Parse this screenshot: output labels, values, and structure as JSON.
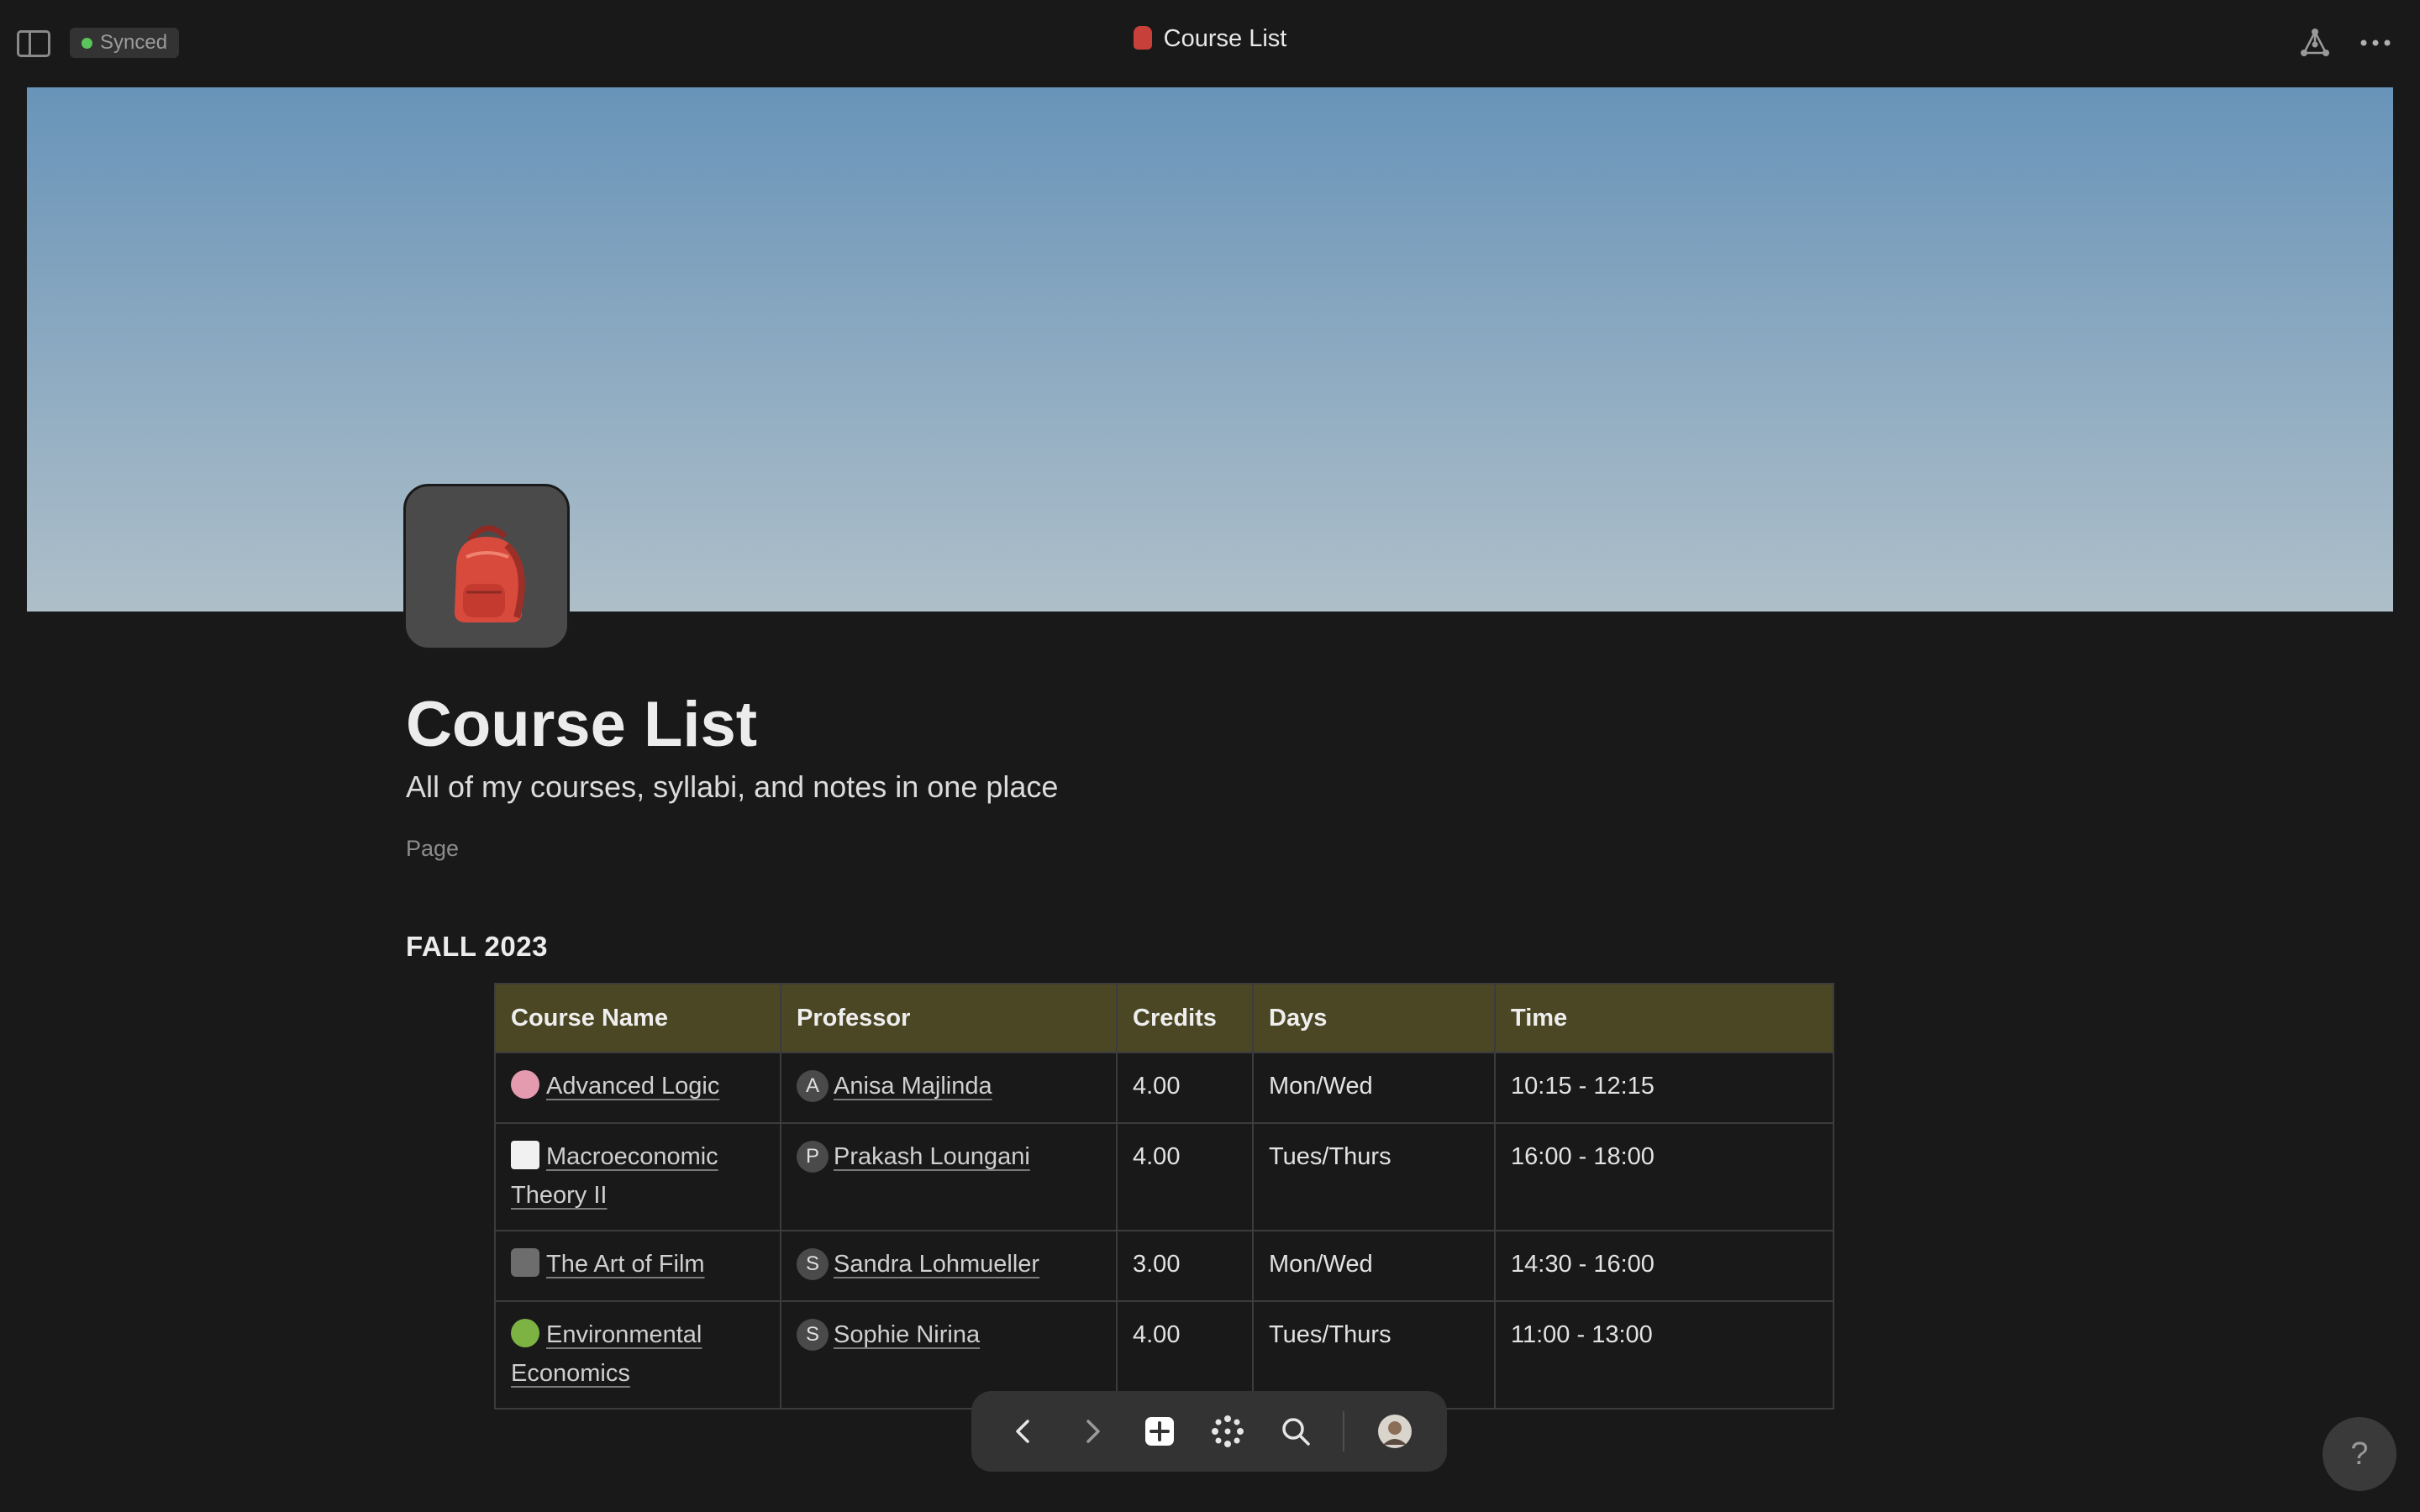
{
  "topbar": {
    "sync_status": "Synced",
    "title": "Course List"
  },
  "page": {
    "title": "Course List",
    "subtitle": "All of my courses, syllabi, and notes in one place",
    "type_label": "Page",
    "section_heading": "FALL 2023"
  },
  "table": {
    "headers": [
      "Course Name",
      "Professor",
      "Credits",
      "Days",
      "Time"
    ],
    "rows": [
      {
        "icon": "brain-emoji",
        "course": "Advanced Logic",
        "prof_initial": "A",
        "professor": "Anisa Majlinda",
        "credits": "4.00",
        "days": "Mon/Wed",
        "time": "10:15 - 12:15"
      },
      {
        "icon": "chart-increasing-emoji",
        "course": "Macroeconomic Theory II",
        "prof_initial": "P",
        "professor": "Prakash Loungani",
        "credits": "4.00",
        "days": "Tues/Thurs",
        "time": "16:00 - 18:00"
      },
      {
        "icon": "movie-camera-emoji",
        "course": "The Art of Film",
        "prof_initial": "S",
        "professor": "Sandra Lohmueller",
        "credits": "3.00",
        "days": "Mon/Wed",
        "time": "14:30 - 16:00"
      },
      {
        "icon": "tree-emoji",
        "course": "Environmental Economics",
        "prof_initial": "S",
        "professor": "Sophie Nirina",
        "credits": "4.00",
        "days": "Tues/Thurs",
        "time": "11:00 - 13:00"
      }
    ]
  },
  "help": {
    "label": "?"
  },
  "colors": {
    "background": "#191919",
    "table_header": "#4b4724",
    "synced_dot": "#5bc45b",
    "cover_top": "#6894b9",
    "cover_bottom": "#aebfc9"
  }
}
